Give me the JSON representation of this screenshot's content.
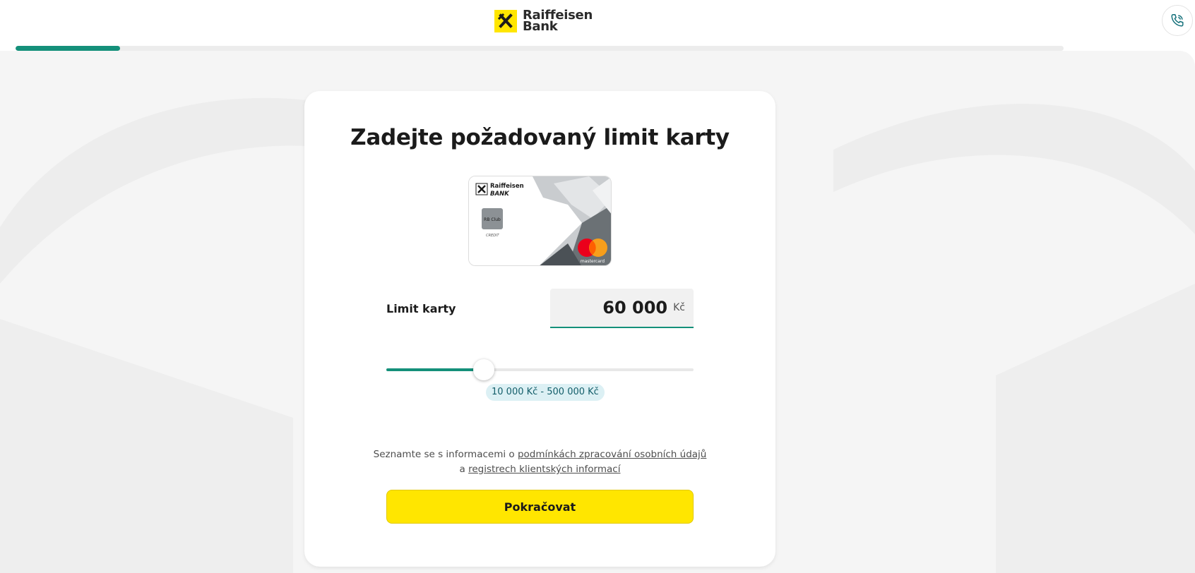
{
  "header": {
    "logo_line1": "Raiffeisen",
    "logo_line2": "Bank",
    "phone_icon": "phone-call-icon"
  },
  "progress": {
    "value": 0.1
  },
  "card": {
    "title": "Zadejte požadovaný limit karty",
    "card_brand_line1": "Raiffeisen",
    "card_brand_line2": "BANK",
    "card_badge": "RB Club",
    "card_type": "CREDIT",
    "card_network": "mastercard",
    "limit_label": "Limit karty",
    "limit_value": "60 000",
    "limit_currency": "Kč",
    "slider": {
      "min": 10000,
      "max": 500000,
      "value": 60000
    },
    "range_text": "10 000 Kč - 500 000 Kč",
    "info_prefix": "Seznamte se s informacemi o ",
    "info_link1": "podmínkách zpracování osobních údajů",
    "info_middle": "a ",
    "info_link2": "registrech klientských informací",
    "continue_label": "Pokračovat"
  },
  "colors": {
    "accent": "#14907a",
    "brand_yellow": "#ffe600",
    "background": "#f5f5f5",
    "range_pill": "#dcf0f4"
  }
}
